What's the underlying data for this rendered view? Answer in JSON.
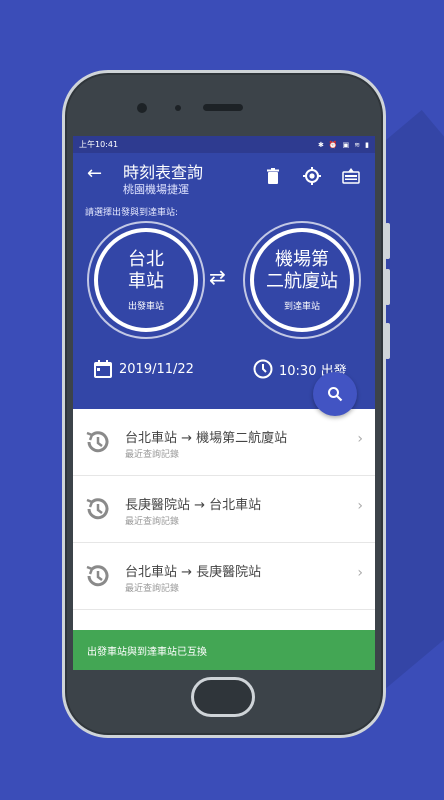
{
  "status": {
    "time": "上午10:41",
    "icons": [
      "bluetooth-icon",
      "alarm-icon",
      "sim-icon",
      "wifi-icon",
      "battery-icon"
    ]
  },
  "appbar": {
    "title": "時刻表查詢",
    "subtitle": "桃園機場捷運"
  },
  "prompt": "請選擇出發與到達車站:",
  "from": {
    "name_line1": "台北",
    "name_line2": "車站",
    "role": "出發車站"
  },
  "to": {
    "name_line1": "機場第",
    "name_line2": "二航廈站",
    "role": "到達車站"
  },
  "swap_icon": "⇄",
  "date": "2019/11/22",
  "time": "10:30 出發",
  "history": [
    {
      "route": "台北車站 → 機場第二航廈站",
      "label": "最近查詢記錄"
    },
    {
      "route": "長庚醫院站 → 台北車站",
      "label": "最近查詢記錄"
    },
    {
      "route": "台北車站 → 長庚醫院站",
      "label": "最近查詢記錄"
    }
  ],
  "snackbar": "出發車站與到達車站已互換",
  "colors": {
    "primary": "#3346a7",
    "background": "#3b4db8",
    "snackbar": "#43a654",
    "fab": "#4254c3"
  }
}
